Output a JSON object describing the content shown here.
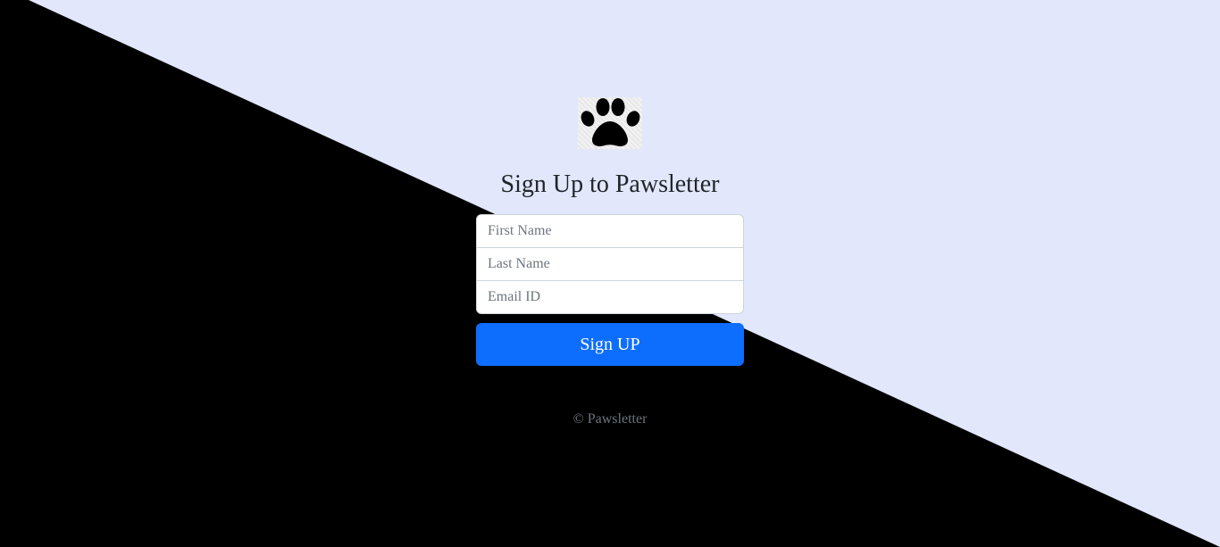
{
  "colors": {
    "background_light": "#e2e7fc",
    "background_dark": "#000000",
    "primary": "#0d6efd",
    "muted_text": "#6c757d"
  },
  "logo": {
    "icon": "paw-icon"
  },
  "form": {
    "title": "Sign Up to Pawsletter",
    "first_name_placeholder": "First Name",
    "last_name_placeholder": "Last Name",
    "email_placeholder": "Email ID",
    "submit_label": "Sign UP"
  },
  "footer": {
    "text": "© Pawsletter"
  }
}
